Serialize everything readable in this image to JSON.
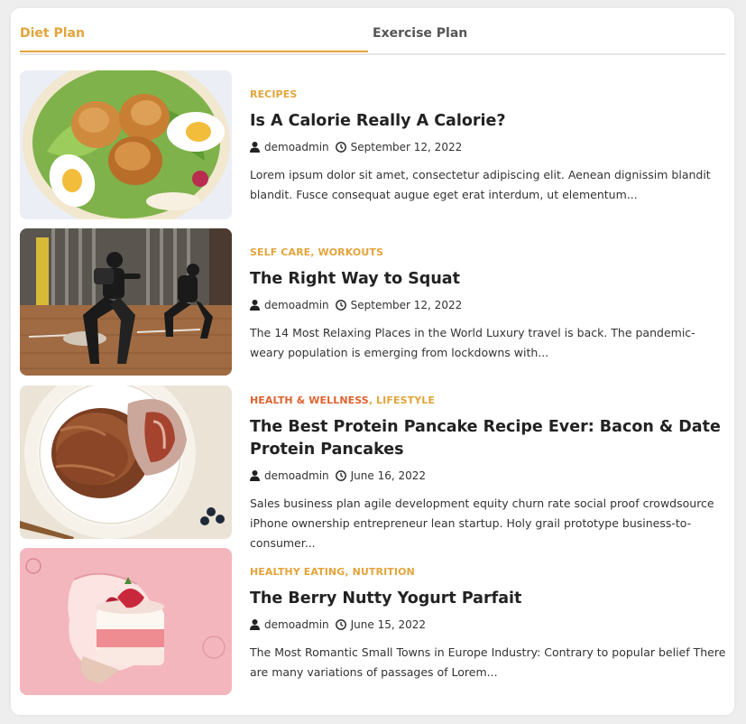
{
  "tabs": [
    {
      "label": "Diet Plan"
    },
    {
      "label": "Exercise Plan"
    }
  ],
  "posts": [
    {
      "categories": [
        "RECIPES"
      ],
      "title": "Is A Calorie Really A Calorie?",
      "author": "demoadmin",
      "date": "September 12, 2022",
      "excerpt": "Lorem ipsum dolor sit amet, consectetur adipiscing elit. Aenean dignissim blandit blandit. Fusce consequat augue eget erat interdum, ut elementum..."
    },
    {
      "categories": [
        "SELF CARE",
        "WORKOUTS"
      ],
      "title": "The Right Way to Squat",
      "author": "demoadmin",
      "date": "September 12, 2022",
      "excerpt": "The 14 Most Relaxing Places in the World Luxury travel is back. The pandemic-weary population is emerging from lockdowns with..."
    },
    {
      "categories": [
        "HEALTH & WELLNESS",
        "LIFESTYLE"
      ],
      "title": "The Best Protein Pancake Recipe Ever: Bacon & Date Protein Pancakes",
      "author": "demoadmin",
      "date": "June 16, 2022",
      "excerpt": "Sales business plan agile development equity churn rate social proof crowdsource iPhone ownership entrepreneur lean startup. Holy grail prototype business-to-consumer..."
    },
    {
      "categories": [
        "HEALTHY EATING",
        "NUTRITION"
      ],
      "title": "The Berry Nutty Yogurt Parfait",
      "author": "demoadmin",
      "date": "June 15, 2022",
      "excerpt": "The Most Romantic Small Towns in Europe Industry: Contrary to popular belief There are many variations of passages of Lorem..."
    }
  ],
  "separator": ", ",
  "colors": {
    "accent": "#e3a43c",
    "category_red": "#e0622f"
  }
}
